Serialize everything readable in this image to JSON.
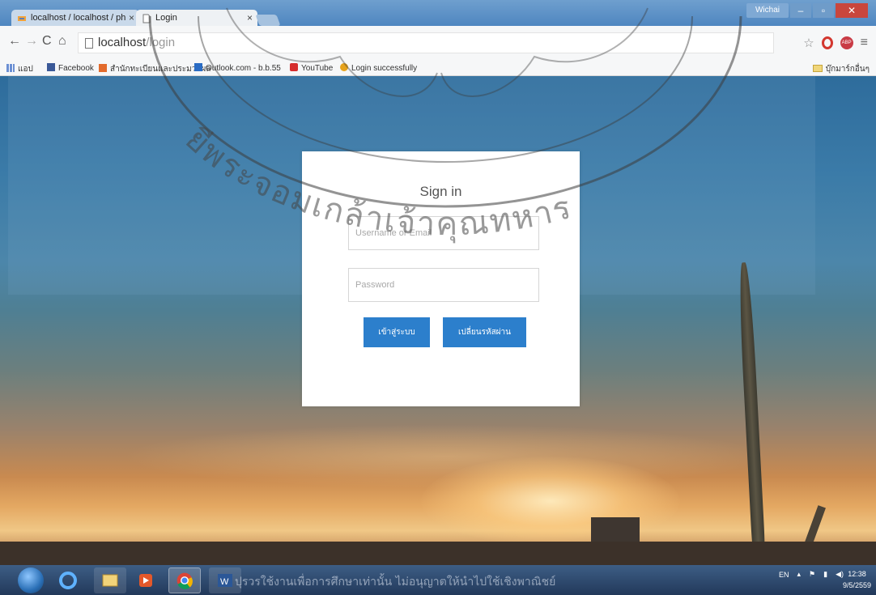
{
  "browser": {
    "tabs": [
      {
        "label": "localhost / localhost / ph",
        "active": false
      },
      {
        "label": "Login",
        "active": true
      }
    ],
    "window_user": "Wichai",
    "address": {
      "host": "localhost",
      "path": "/login"
    },
    "bookmarks": [
      {
        "label": "แอป",
        "icon": "apps-grid-icon"
      },
      {
        "label": "Facebook",
        "icon": "facebook-icon"
      },
      {
        "label": "สำนักทะเบียนและประมวลผล",
        "icon": "site-icon"
      },
      {
        "label": "Outlook.com - b.b.55",
        "icon": "outlook-icon"
      },
      {
        "label": "YouTube",
        "icon": "youtube-icon"
      },
      {
        "label": "Login successfully",
        "icon": "site-icon"
      }
    ],
    "other_bookmarks": "บุ๊กมาร์กอื่นๆ"
  },
  "login": {
    "title": "Sign in",
    "username_placeholder": "Username or Email",
    "password_placeholder": "Password",
    "login_button": "เข้าสู่ระบบ",
    "change_password_button": "เปลี่ยนรหัสผ่าน"
  },
  "watermark": {
    "text": "ยีพระจอมเกล้าเจ้าคุณทหาร"
  },
  "taskbar": {
    "language": "EN",
    "time": "12:38",
    "date": "9/5/2559",
    "footer_overlay": "ปุรวรใช้งานเพื่อการศึกษาเท่านั้น ไม่อนุญาตให้นำไปใช้เชิงพาณิชย์"
  },
  "colors": {
    "primary_button": "#2c7fcc",
    "card_background": "#ffffff"
  }
}
